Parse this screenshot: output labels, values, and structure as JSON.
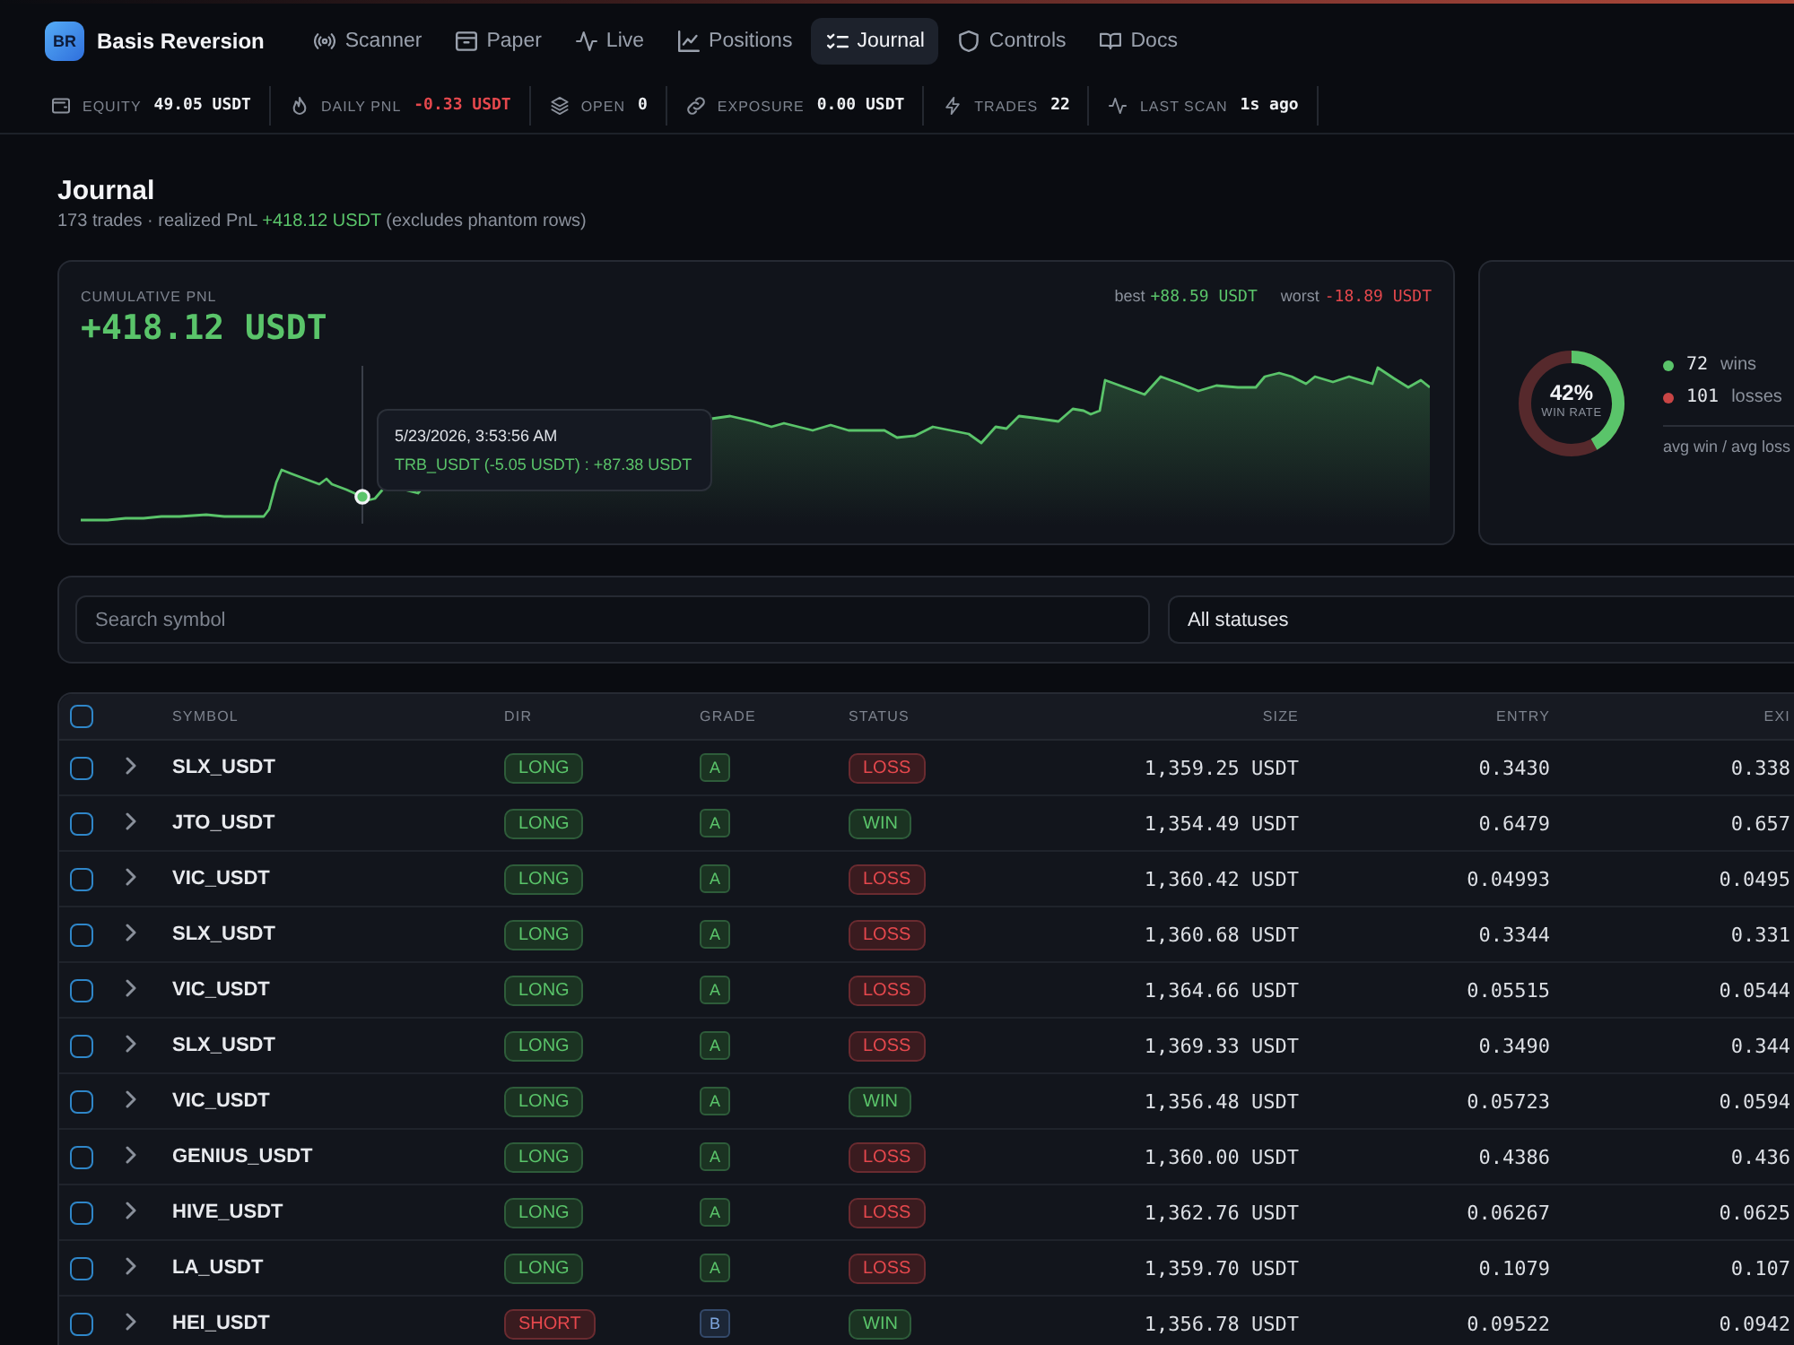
{
  "app": {
    "logo": "BR",
    "name": "Basis Reversion"
  },
  "nav": [
    {
      "label": "Scanner",
      "selected": false
    },
    {
      "label": "Paper",
      "selected": false
    },
    {
      "label": "Live",
      "selected": false
    },
    {
      "label": "Positions",
      "selected": false
    },
    {
      "label": "Journal",
      "selected": true
    },
    {
      "label": "Controls",
      "selected": false
    },
    {
      "label": "Docs",
      "selected": false
    }
  ],
  "stats": [
    {
      "label": "EQUITY",
      "value": "49.05 USDT",
      "negative": false
    },
    {
      "label": "DAILY PNL",
      "value": "-0.33 USDT",
      "negative": true
    },
    {
      "label": "OPEN",
      "value": "0",
      "negative": false
    },
    {
      "label": "EXPOSURE",
      "value": "0.00 USDT",
      "negative": false
    },
    {
      "label": "TRADES",
      "value": "22",
      "negative": false
    },
    {
      "label": "LAST SCAN",
      "value": "1s ago",
      "negative": false
    }
  ],
  "page": {
    "title": "Journal",
    "summary": {
      "before": "173 trades · realized PnL",
      "pnl": "+418.12 USDT",
      "after": "(excludes phantom rows)"
    }
  },
  "pnl_card": {
    "label": "CUMULATIVE PNL",
    "value": "+418.12 USDT",
    "extremes": [
      {
        "label": "best",
        "value": "+88.59 USDT",
        "negative": false
      },
      {
        "label": "worst",
        "value": "-18.89 USDT",
        "negative": true
      }
    ],
    "tooltip": {
      "time": "5/23/2026, 3:53:56 AM",
      "detail": "TRB_USDT (-5.05 USDT) : +87.38 USDT"
    }
  },
  "win_card": {
    "level": 0.42,
    "percent": "42%",
    "caption": "WIN RATE",
    "legend": [
      {
        "count": "72",
        "label": "wins",
        "color": "#5ac46a"
      },
      {
        "count": "101",
        "label": "losses",
        "color": "#c94545"
      }
    ],
    "footer": "avg win / avg loss"
  },
  "filters": {
    "search": {
      "placeholder": "Search symbol"
    },
    "status": {
      "value": "All statuses"
    }
  },
  "table": {
    "select_all": {
      "checked": false
    },
    "columns": [
      "SYMBOL",
      "DIR",
      "GRADE",
      "STATUS",
      "SIZE",
      "ENTRY",
      "EXI"
    ],
    "rows": [
      {
        "checked": false,
        "expanded": false,
        "symbol": "SLX_USDT",
        "dir": "LONG",
        "short": false,
        "grade": {
          "label": "A",
          "kind": "primary"
        },
        "status": "LOSS",
        "win": false,
        "size": "1,359.25 USDT",
        "entry": "0.3430",
        "column_7": "0.338"
      },
      {
        "checked": false,
        "expanded": false,
        "symbol": "JTO_USDT",
        "dir": "LONG",
        "short": false,
        "grade": {
          "label": "A",
          "kind": "primary"
        },
        "status": "WIN",
        "win": true,
        "size": "1,354.49 USDT",
        "entry": "0.6479",
        "column_7": "0.657"
      },
      {
        "checked": false,
        "expanded": false,
        "symbol": "VIC_USDT",
        "dir": "LONG",
        "short": false,
        "grade": {
          "label": "A",
          "kind": "primary"
        },
        "status": "LOSS",
        "win": false,
        "size": "1,360.42 USDT",
        "entry": "0.04993",
        "column_7": "0.0495"
      },
      {
        "checked": false,
        "expanded": false,
        "symbol": "SLX_USDT",
        "dir": "LONG",
        "short": false,
        "grade": {
          "label": "A",
          "kind": "primary"
        },
        "status": "LOSS",
        "win": false,
        "size": "1,360.68 USDT",
        "entry": "0.3344",
        "column_7": "0.331"
      },
      {
        "checked": false,
        "expanded": false,
        "symbol": "VIC_USDT",
        "dir": "LONG",
        "short": false,
        "grade": {
          "label": "A",
          "kind": "primary"
        },
        "status": "LOSS",
        "win": false,
        "size": "1,364.66 USDT",
        "entry": "0.05515",
        "column_7": "0.0544"
      },
      {
        "checked": false,
        "expanded": false,
        "symbol": "SLX_USDT",
        "dir": "LONG",
        "short": false,
        "grade": {
          "label": "A",
          "kind": "primary"
        },
        "status": "LOSS",
        "win": false,
        "size": "1,369.33 USDT",
        "entry": "0.3490",
        "column_7": "0.344"
      },
      {
        "checked": false,
        "expanded": false,
        "symbol": "VIC_USDT",
        "dir": "LONG",
        "short": false,
        "grade": {
          "label": "A",
          "kind": "primary"
        },
        "status": "WIN",
        "win": true,
        "size": "1,356.48 USDT",
        "entry": "0.05723",
        "column_7": "0.0594"
      },
      {
        "checked": false,
        "expanded": false,
        "symbol": "GENIUS_USDT",
        "dir": "LONG",
        "short": false,
        "grade": {
          "label": "A",
          "kind": "primary"
        },
        "status": "LOSS",
        "win": false,
        "size": "1,360.00 USDT",
        "entry": "0.4386",
        "column_7": "0.436"
      },
      {
        "checked": false,
        "expanded": false,
        "symbol": "HIVE_USDT",
        "dir": "LONG",
        "short": false,
        "grade": {
          "label": "A",
          "kind": "primary"
        },
        "status": "LOSS",
        "win": false,
        "size": "1,362.76 USDT",
        "entry": "0.06267",
        "column_7": "0.0625"
      },
      {
        "checked": false,
        "expanded": false,
        "symbol": "LA_USDT",
        "dir": "LONG",
        "short": false,
        "grade": {
          "label": "A",
          "kind": "primary"
        },
        "status": "LOSS",
        "win": false,
        "size": "1,359.70 USDT",
        "entry": "0.1079",
        "column_7": "0.107"
      },
      {
        "checked": false,
        "expanded": false,
        "symbol": "HEI_USDT",
        "dir": "SHORT",
        "short": true,
        "grade": {
          "label": "B",
          "kind": "secondary"
        },
        "status": "WIN",
        "win": true,
        "size": "1,356.78 USDT",
        "entry": "0.09522",
        "column_7": "0.0942"
      }
    ]
  }
}
